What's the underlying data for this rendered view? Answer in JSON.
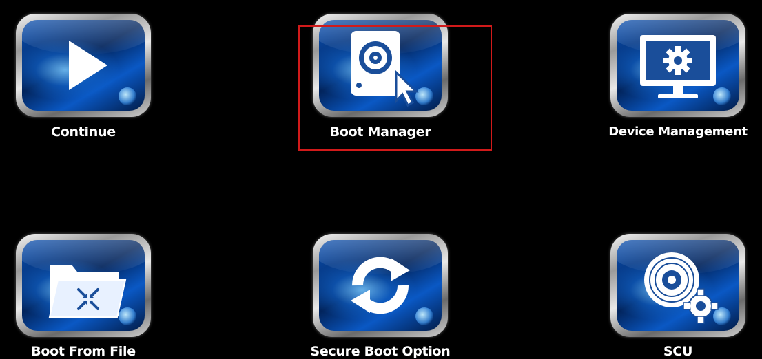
{
  "menu": {
    "items": [
      {
        "label": "Continue",
        "icon": "play-icon"
      },
      {
        "label": "Boot Manager",
        "icon": "boot-disk-icon"
      },
      {
        "label": "Device Management",
        "icon": "monitor-gear-icon"
      },
      {
        "label": "Boot From File",
        "icon": "folder-icon"
      },
      {
        "label": "Secure Boot Option",
        "icon": "refresh-icon"
      },
      {
        "label": "SCU",
        "icon": "disc-gear-icon"
      }
    ],
    "selected_item": "Boot Manager"
  },
  "colors": {
    "background": "#000000",
    "tile_blue": "#0a4fb0",
    "highlight_border": "#d11a1a",
    "label_text": "#ffffff"
  }
}
